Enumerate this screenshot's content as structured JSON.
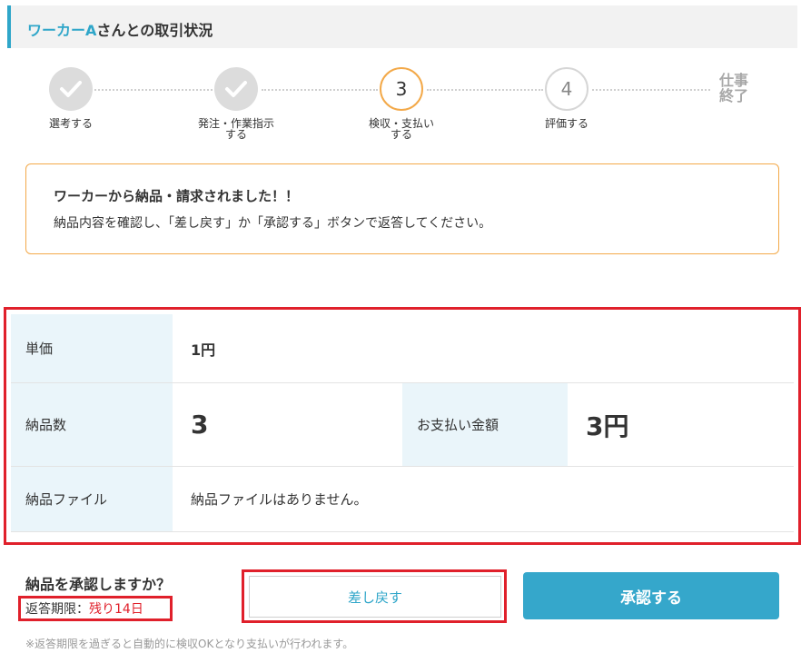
{
  "header": {
    "name": "ワーカーA",
    "suffix": "さんとの取引状況"
  },
  "steps": [
    {
      "label": "選考する",
      "state": "done"
    },
    {
      "label": "発注・作業指示\nする",
      "state": "done"
    },
    {
      "label": "検収・支払い\nする",
      "state": "current",
      "number": "3"
    },
    {
      "label": "評価する",
      "state": "todo",
      "number": "4"
    }
  ],
  "final_step": "仕事\n終了",
  "notice": {
    "title": "ワーカーから納品・請求されました！！",
    "text": "納品内容を確認し、「差し戻す」か「承認する」ボタンで返答してください。"
  },
  "details": {
    "unit_price_label": "単価",
    "unit_price_value": "1円",
    "quantity_label": "納品数",
    "quantity_value": "3",
    "payment_label": "お支払い金額",
    "payment_value": "3円",
    "file_label": "納品ファイル",
    "file_value": "納品ファイルはありません。"
  },
  "confirm": {
    "question": "納品を承認しますか？",
    "deadline_label": "返答期限：",
    "deadline_remaining": "残り14日",
    "return_button": "差し戻す",
    "approve_button": "承認する",
    "footnote": "※返答期限を過ぎると自動的に検収OKとなり支払いが行われます。"
  },
  "colors": {
    "accent": "#2fa6c9",
    "warning": "#f3a949",
    "alert": "#e0202b",
    "label_bg": "#eaf5fa"
  }
}
